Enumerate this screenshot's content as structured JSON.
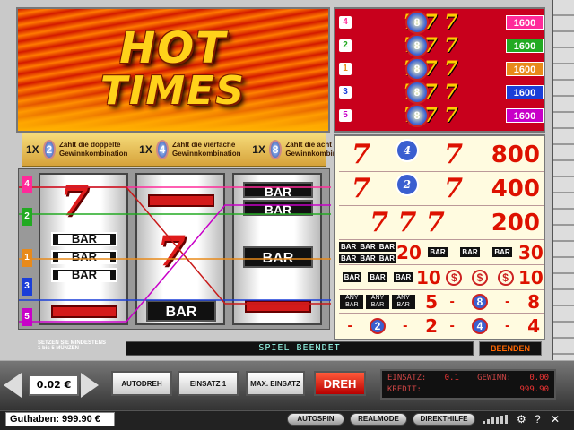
{
  "logo": {
    "line1": "HOT",
    "line2": "TIMES"
  },
  "multipliers": [
    {
      "times": "1X",
      "coin": "2",
      "text": "Zahlt die doppelte Gewinnkombination"
    },
    {
      "times": "1X",
      "coin": "4",
      "text": "Zahlt die vierfache Gewinnkombination"
    },
    {
      "times": "1X",
      "coin": "8",
      "text": "Zahlt die acht mal Gewinnkombination"
    }
  ],
  "paylines": [
    {
      "num": "4",
      "amount": "1600",
      "color": "#ff2a9a"
    },
    {
      "num": "2",
      "amount": "1600",
      "color": "#22aa22"
    },
    {
      "num": "1",
      "amount": "1600",
      "color": "#e88a1a"
    },
    {
      "num": "3",
      "amount": "1600",
      "color": "#1a3ed8"
    },
    {
      "num": "5",
      "amount": "1600",
      "color": "#c800c8"
    }
  ],
  "pay_coin_label": "8",
  "pays_table": [
    {
      "value": "800"
    },
    {
      "value": "400"
    },
    {
      "value": "200"
    },
    {
      "value_left": "20",
      "value_right": "30"
    },
    {
      "value_left": "10",
      "value_right": "10"
    },
    {
      "value_left": "5",
      "value_right": "8"
    },
    {
      "value_left": "2",
      "value_right": "4"
    }
  ],
  "reel_labels": {
    "bar": "BAR"
  },
  "line_markers": [
    "4",
    "2",
    "1",
    "3",
    "5"
  ],
  "info_left": {
    "line1": "SETZEN SIE MINDESTENS",
    "line2": "1 bis 5 MÜNZEN"
  },
  "status": "SPIEL BEENDET",
  "beenden": "BEENDEN",
  "coin_value": "0.02 €",
  "buttons": {
    "autodreh": "AUTODREH",
    "einsatz1": "EINSATZ 1",
    "max_einsatz": "MAX. EINSATZ",
    "dreh": "DREH"
  },
  "readout": {
    "einsatz_label": "EINSATZ:",
    "einsatz_value": "0.1",
    "gewinn_label": "GEWINN:",
    "gewinn_value": "0.00",
    "kredit_label": "KREDIT:",
    "kredit_value": "999.90"
  },
  "guthaben": "Guthaben:  999.90 €",
  "bottom": {
    "autospin": "AUTOSPIN",
    "realmode": "REALMODE",
    "direkthilfe": "DIREKTHILFE"
  }
}
